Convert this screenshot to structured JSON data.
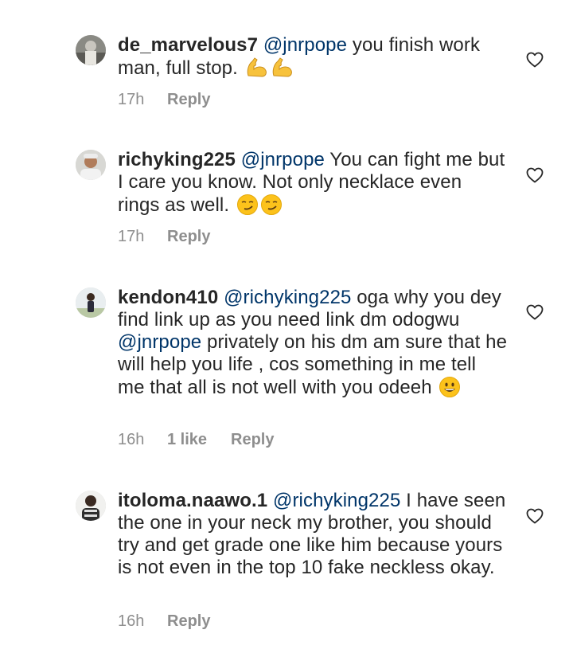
{
  "comments": [
    {
      "username": "de_marvelous7",
      "segments": [
        {
          "type": "mention",
          "text": "@jnrpope"
        },
        {
          "type": "text",
          "text": " you finish work man, full stop. "
        },
        {
          "type": "emoji",
          "icon": "flexed-biceps-icon",
          "glyph": "💪"
        },
        {
          "type": "emoji",
          "icon": "flexed-biceps-icon",
          "glyph": "💪"
        }
      ],
      "time": "17h",
      "likes": "",
      "reply": "Reply"
    },
    {
      "username": "richyking225",
      "segments": [
        {
          "type": "mention",
          "text": "@jnrpope"
        },
        {
          "type": "text",
          "text": " You can fight me but I care you know. Not only necklace even rings as well. "
        },
        {
          "type": "emoji",
          "icon": "smirking-face-icon",
          "glyph": "😏"
        },
        {
          "type": "emoji",
          "icon": "smirking-face-icon",
          "glyph": "😏"
        }
      ],
      "time": "17h",
      "likes": "",
      "reply": "Reply"
    },
    {
      "username": "kendon410",
      "segments": [
        {
          "type": "mention",
          "text": "@richyking225"
        },
        {
          "type": "text",
          "text": " oga why you dey find link up as you need link dm odogwu "
        },
        {
          "type": "mention",
          "text": "@jnrpope"
        },
        {
          "type": "text",
          "text": " privately on his dm am sure that he will help you life , cos something in me tell me that all is not well with you odeeh "
        },
        {
          "type": "emoji",
          "icon": "grinning-face-icon",
          "glyph": "😀"
        }
      ],
      "time": "16h",
      "likes": "1 like",
      "reply": "Reply"
    },
    {
      "username": "itoloma.naawo.1",
      "segments": [
        {
          "type": "mention",
          "text": "@richyking225"
        },
        {
          "type": "text",
          "text": " I have seen the one in your neck my brother, you should try and get grade one like him because yours is not even in the top 10 fake neckless okay."
        }
      ],
      "time": "16h",
      "likes": "",
      "reply": "Reply"
    }
  ],
  "colors": {
    "text": "#262626",
    "mention": "#003569",
    "meta": "#8e8e8e"
  }
}
